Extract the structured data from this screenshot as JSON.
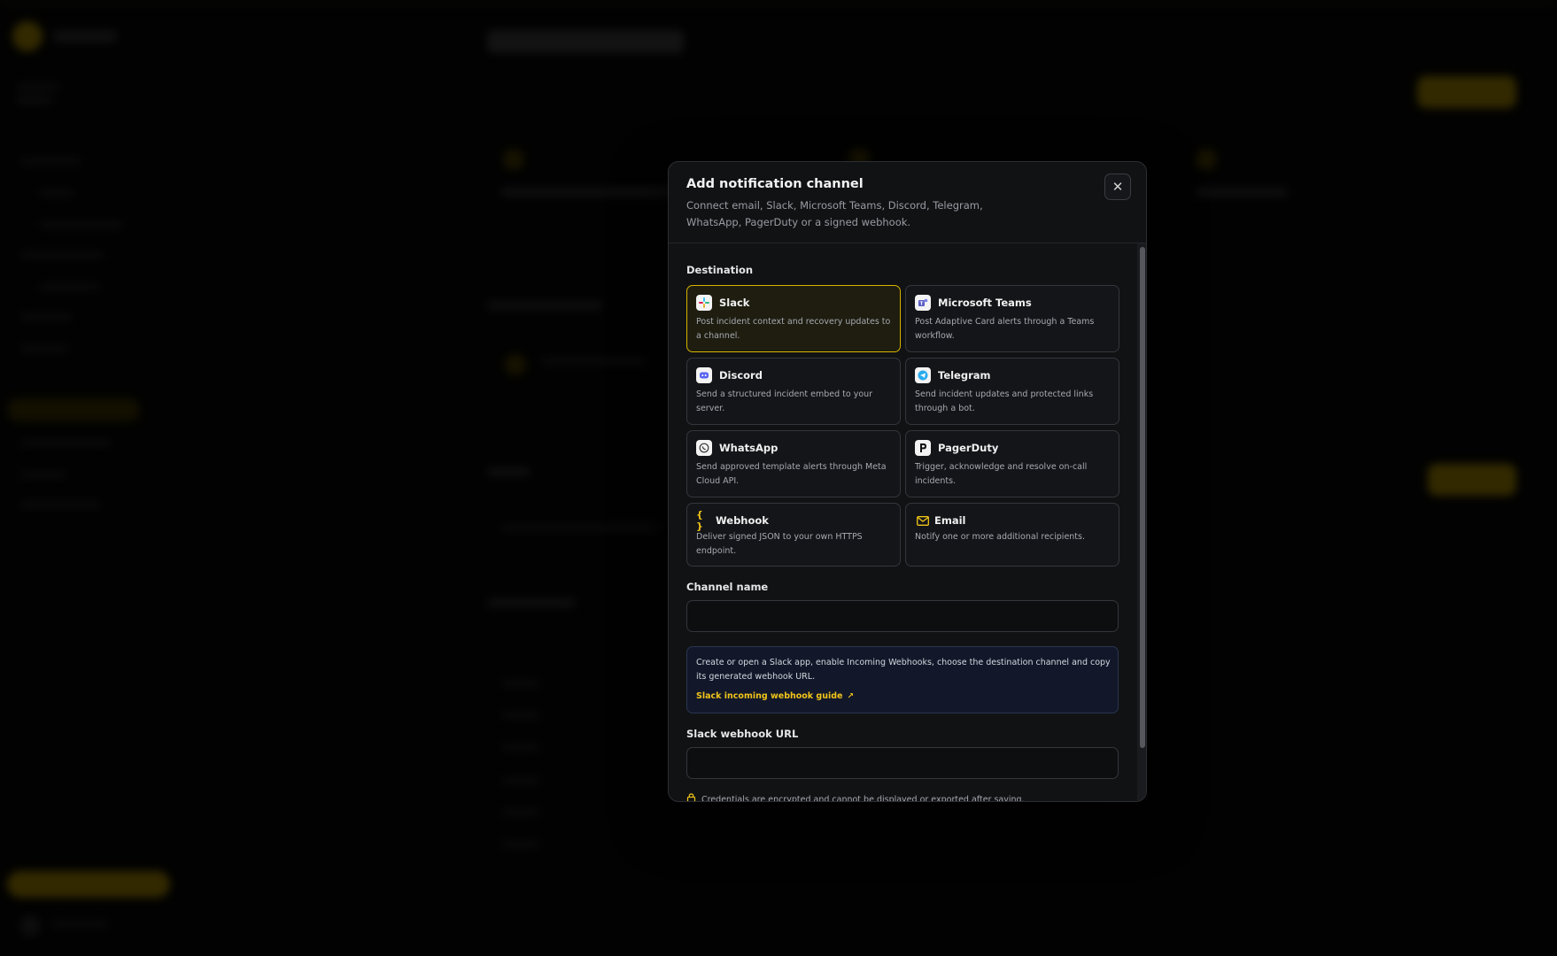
{
  "modal": {
    "title": "Add notification channel",
    "subtitle": "Connect email, Slack, Microsoft Teams, Discord, Telegram, WhatsApp, PagerDuty or a signed webhook.",
    "close_icon": "close-icon",
    "destination_label": "Destination",
    "destinations": [
      {
        "name": "Slack",
        "desc": "Post incident context and recovery updates to a channel.",
        "icon": "slack-icon",
        "selected": true
      },
      {
        "name": "Microsoft Teams",
        "desc": "Post Adaptive Card alerts through a Teams workflow.",
        "icon": "teams-icon",
        "selected": false
      },
      {
        "name": "Discord",
        "desc": "Send a structured incident embed to your server.",
        "icon": "discord-icon",
        "selected": false
      },
      {
        "name": "Telegram",
        "desc": "Send incident updates and protected links through a bot.",
        "icon": "telegram-icon",
        "selected": false
      },
      {
        "name": "WhatsApp",
        "desc": "Send approved template alerts through Meta Cloud API.",
        "icon": "whatsapp-icon",
        "selected": false
      },
      {
        "name": "PagerDuty",
        "desc": "Trigger, acknowledge and resolve on-call incidents.",
        "icon": "pagerduty-icon",
        "selected": false
      },
      {
        "name": "Webhook",
        "desc": "Deliver signed JSON to your own HTTPS endpoint.",
        "icon": "webhook-icon",
        "selected": false
      },
      {
        "name": "Email",
        "desc": "Notify one or more additional recipients.",
        "icon": "mail-icon",
        "selected": false
      }
    ],
    "channel_name_label": "Channel name",
    "channel_name_value": "",
    "info": {
      "text": "Create or open a Slack app, enable Incoming Webhooks, choose the destination channel and copy its generated webhook URL.",
      "link": "Slack incoming webhook guide"
    },
    "webhook_url_label": "Slack webhook URL",
    "webhook_url_value": "",
    "credentials_note": "Credentials are encrypted and cannot be displayed or exported after saving."
  },
  "colors": {
    "accent": "#f0c419",
    "selected_border": "#d8b400",
    "modal_bg": "#111214",
    "info_bg": "#12182a"
  }
}
